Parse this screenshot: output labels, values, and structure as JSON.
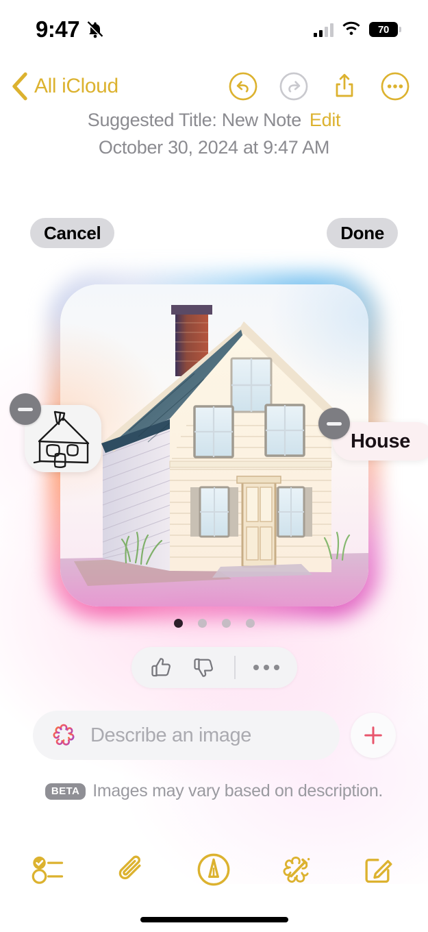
{
  "status_bar": {
    "time": "9:47",
    "silent_icon": "bell-slash-icon",
    "battery_level": "70",
    "signal_icon": "cellular-signal-icon",
    "wifi_icon": "wifi-icon"
  },
  "nav": {
    "back_label": "All iCloud",
    "undo_label": "Undo",
    "redo_label": "Redo",
    "share_label": "Share",
    "more_label": "More"
  },
  "note": {
    "suggested_title": "Suggested Title: New Note",
    "edit_label": "Edit",
    "date": "October 30, 2024 at 9:47 AM"
  },
  "playground": {
    "cancel_label": "Cancel",
    "done_label": "Done",
    "concept_chips": [
      {
        "type": "sketch",
        "label": "",
        "remove_label": "Remove"
      },
      {
        "type": "text",
        "label": "House",
        "remove_label": "Remove"
      }
    ],
    "page_dots": {
      "count": 4,
      "active": 0
    },
    "feedback": {
      "like_label": "Like",
      "dislike_label": "Dislike",
      "more_label": "More options"
    },
    "prompt": {
      "placeholder": "Describe an image",
      "value": "",
      "add_label": "Add concept"
    },
    "beta_badge": "BETA",
    "beta_text": "Images may vary based on description."
  },
  "toolbar": {
    "items": [
      {
        "name": "checklist-icon",
        "label": "Checklist"
      },
      {
        "name": "paperclip-icon",
        "label": "Attach"
      },
      {
        "name": "markup-pen-icon",
        "label": "Markup"
      },
      {
        "name": "image-playground-icon",
        "label": "Image Playground"
      },
      {
        "name": "compose-icon",
        "label": "New Note"
      }
    ]
  },
  "colors": {
    "accent_gold": "#dcb22f",
    "accent_pink": "#e8556c",
    "muted_gray": "#8b8b90",
    "badge_gray": "#7d7d82"
  }
}
